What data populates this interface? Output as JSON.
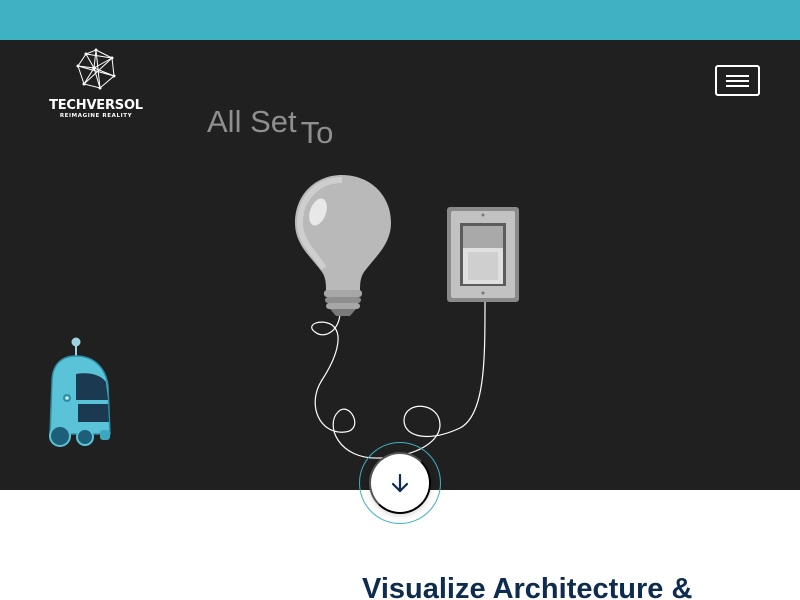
{
  "brand": {
    "name": "TECHVERSOL",
    "tagline": "REIMAGINE REALITY"
  },
  "hero": {
    "headline_part1": "All Set",
    "headline_part2": "To"
  },
  "section": {
    "title": "Visualize Architecture &"
  },
  "icons": {
    "menu": "hamburger-icon",
    "scroll": "arrow-down-icon",
    "logo": "geodesic-sphere-icon"
  },
  "colors": {
    "accent": "#3eb1c2",
    "hero_background": "#202020",
    "headline": "#8f8f8f",
    "section_title": "#0e2c4d"
  }
}
